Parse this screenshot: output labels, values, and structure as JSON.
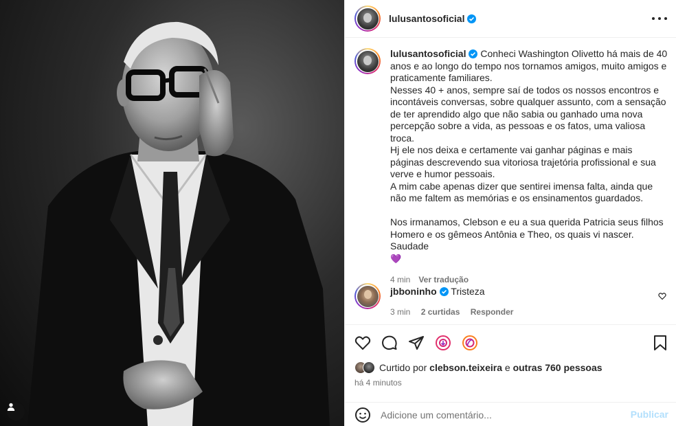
{
  "post": {
    "username": "lulusantosoficial",
    "caption": {
      "username": "lulusantosoficial",
      "paragraph1": "Conheci Washington Olivetto há mais de 40 anos e ao longo do tempo nos tornamos amigos, muito amigos e praticamente familiares.",
      "paragraph2": "Nesses 40 + anos, sempre saí de todos os nossos encontros e incontáveis conversas, sobre qualquer assunto, com a sensação de ter aprendido algo que não sabia ou ganhado uma nova percepção sobre a vida, as pessoas e os fatos, uma valiosa troca.",
      "paragraph3": "Hj ele nos deixa e certamente vai ganhar páginas e mais páginas descrevendo sua vitoriosa trajetória profissional e sua verve e humor pessoais.",
      "paragraph4": "A mim cabe apenas dizer que sentirei imensa falta, ainda que não me faltem as memórias e os ensinamentos guardados.",
      "paragraph5": "Nos irmanamos, Clebson e eu a sua querida Patricia seus filhos Homero e os gêmeos Antônia e Theo, os quais vi nascer.",
      "paragraph6": "Saudade",
      "emoji": "💜",
      "time": "4 min",
      "translate": "Ver tradução"
    },
    "comment": {
      "username": "jbboninho",
      "text": "Tristeza",
      "time": "3 min",
      "likes": "2 curtidas",
      "reply": "Responder"
    },
    "likes": {
      "prefix": "Curtido por",
      "user": "clebson.teixeira",
      "connector": "e",
      "others": "outras 760 pessoas"
    },
    "time_ago": "há 4 minutos",
    "add_comment_placeholder": "Adicione um comentário...",
    "publish_label": "Publicar"
  },
  "icons": {
    "like": "heart-icon",
    "comment": "comment-icon",
    "share": "share-icon",
    "save": "bookmark-icon",
    "emoji": "emoji-icon",
    "more": "more-icon",
    "verified": "verified-badge-icon",
    "tag": "user-tag-icon"
  },
  "colors": {
    "verified": "#0095f6",
    "publish_disabled": "#b2dffc",
    "secondary_text": "#737373"
  }
}
